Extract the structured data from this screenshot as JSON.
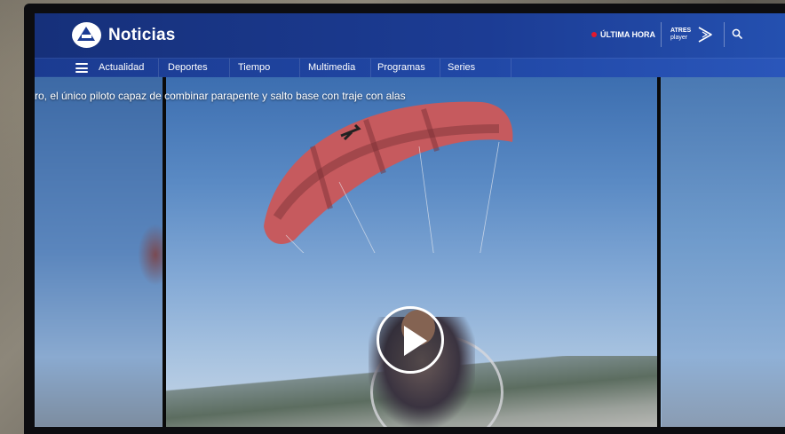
{
  "header": {
    "brand": "Noticias",
    "breaking_label": "ÚLTIMA HORA",
    "partner_line1": "ATRES",
    "partner_line2": "player"
  },
  "nav": {
    "items": [
      {
        "label": "Actualidad"
      },
      {
        "label": "Deportes"
      },
      {
        "label": "Tiempo"
      },
      {
        "label": "Multimedia"
      },
      {
        "label": "Programas"
      },
      {
        "label": "Series"
      }
    ]
  },
  "video": {
    "caption": "ro, el único piloto capaz de combinar parapente y salto base con traje con alas"
  },
  "colors": {
    "header_bg": "#1c3c94",
    "breaking_dot": "#e3182d",
    "canopy": "#c65a5e"
  },
  "icons": {
    "menu": "hamburger-icon",
    "search": "search-icon",
    "play": "play-icon",
    "logo": "antena3-logo-icon",
    "partner": "atresplayer-arrow-icon"
  }
}
